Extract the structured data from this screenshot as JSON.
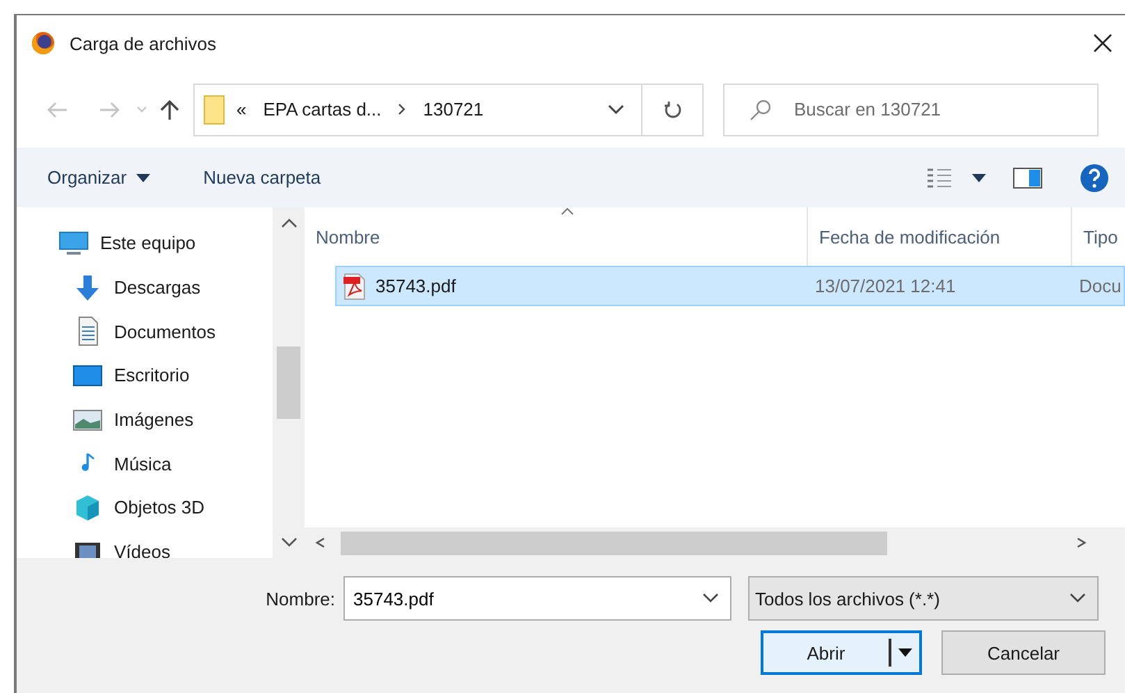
{
  "window": {
    "title": "Carga de archivos"
  },
  "address": {
    "overflow": "«",
    "segments": [
      "EPA cartas d...",
      "130721"
    ]
  },
  "search": {
    "placeholder": "Buscar en 130721"
  },
  "toolbar": {
    "organize": "Organizar",
    "new_folder": "Nueva carpeta"
  },
  "sidebar": {
    "items": [
      {
        "label": "Este equipo",
        "children": [
          {
            "label": "Descargas"
          },
          {
            "label": "Documentos"
          },
          {
            "label": "Escritorio"
          },
          {
            "label": "Imágenes"
          },
          {
            "label": "Música"
          },
          {
            "label": "Objetos 3D"
          },
          {
            "label": "Vídeos"
          }
        ]
      }
    ]
  },
  "table": {
    "columns": [
      "Nombre",
      "Fecha de modificación",
      "Tipo"
    ],
    "rows": [
      {
        "cells": [
          "35743.pdf",
          "13/07/2021 12:41",
          "Docu"
        ],
        "selected": true
      }
    ]
  },
  "file_name": {
    "label": "Nombre:",
    "value": "35743.pdf"
  },
  "file_type": {
    "value": "Todos los archivos (*.*)"
  },
  "buttons": [
    {
      "label": "Abrir",
      "kind": "split"
    },
    {
      "label": "Cancelar",
      "kind": "plain"
    }
  ]
}
